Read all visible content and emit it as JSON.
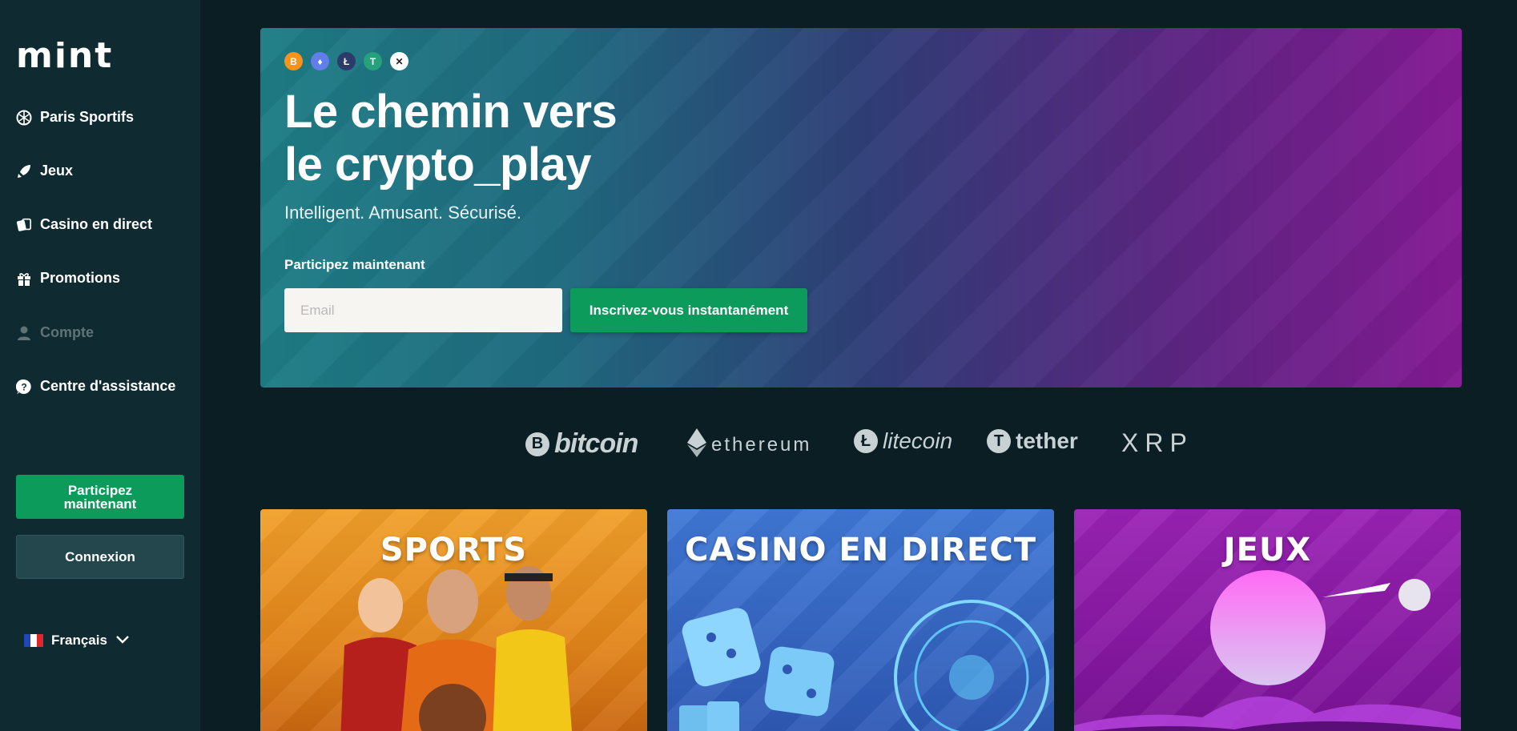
{
  "brand": {
    "logo_text": "mint"
  },
  "sidebar": {
    "items": [
      {
        "label": "Paris Sportifs",
        "icon": "sports-ball-icon"
      },
      {
        "label": "Jeux",
        "icon": "rocket-icon"
      },
      {
        "label": "Casino en direct",
        "icon": "cards-icon"
      },
      {
        "label": "Promotions",
        "icon": "gift-icon"
      },
      {
        "label": "Compte",
        "icon": "user-icon"
      },
      {
        "label": "Centre d'assistance",
        "icon": "help-icon"
      }
    ],
    "join_label": "Participez maintenant",
    "login_label": "Connexion",
    "language": "Français"
  },
  "hero": {
    "coins": [
      "B",
      "♦",
      "Ł",
      "T",
      "✕"
    ],
    "title_line1": "Le chemin vers",
    "title_line2": "le crypto_play",
    "subtitle": "Intelligent. Amusant. Sécurisé.",
    "cta_label": "Participez maintenant",
    "email_placeholder": "Email",
    "signup_button": "Inscrivez-vous instantanément"
  },
  "cryptos": [
    {
      "name": "bitcoin",
      "symbol": "B"
    },
    {
      "name": "ethereum",
      "symbol": "♦"
    },
    {
      "name": "litecoin",
      "symbol": "Ł"
    },
    {
      "name": "tether",
      "symbol": "T"
    },
    {
      "name": "XRP",
      "symbol": "✕"
    }
  ],
  "categories": [
    {
      "title": "SPORTS",
      "color": "#e8901d"
    },
    {
      "title": "CASINO EN DIRECT",
      "color": "#3a69c8"
    },
    {
      "title": "JEUX",
      "color": "#8e1fa8"
    }
  ],
  "colors": {
    "accent": "#0c9b5a",
    "sidebar": "#0f2a30",
    "background": "#0a1e24"
  }
}
